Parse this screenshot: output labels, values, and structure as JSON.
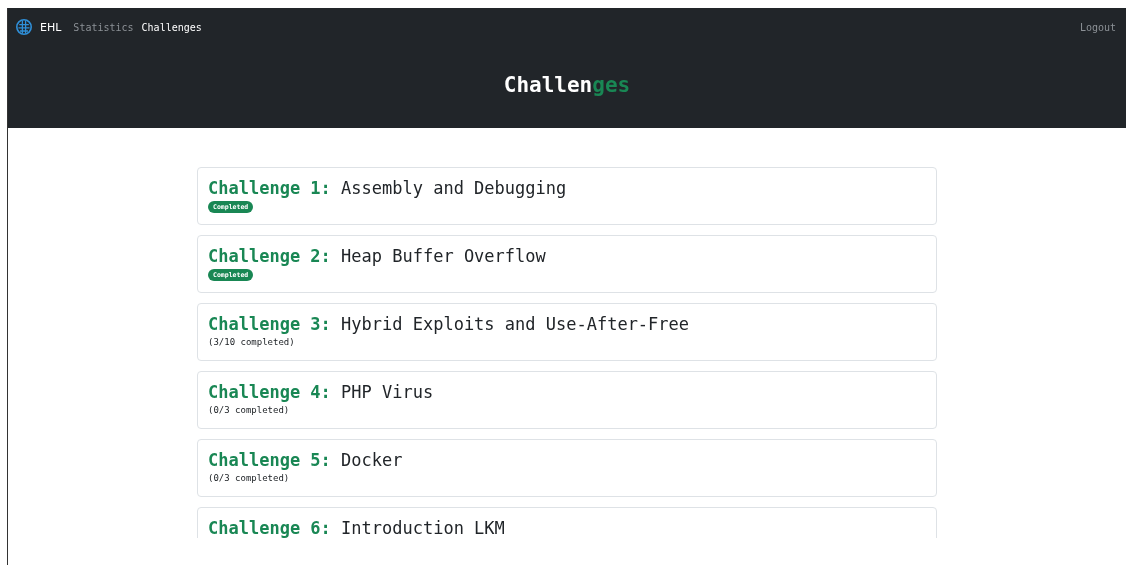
{
  "navbar": {
    "brand": "EHL",
    "links": [
      {
        "label": "Statistics",
        "selected": false
      },
      {
        "label": "Challenges",
        "selected": true
      }
    ],
    "logout": "Logout"
  },
  "header": {
    "title_parts": [
      {
        "text": "Challen",
        "accent": false
      },
      {
        "text": "ges",
        "accent": true
      }
    ]
  },
  "challenges": [
    {
      "label": "Challenge 1:",
      "title": "Assembly and Debugging",
      "status": {
        "kind": "badge",
        "text": "Completed"
      }
    },
    {
      "label": "Challenge 2:",
      "title": "Heap Buffer Overflow",
      "status": {
        "kind": "badge",
        "text": "Completed"
      }
    },
    {
      "label": "Challenge 3:",
      "title": "Hybrid Exploits and Use-After-Free",
      "status": {
        "kind": "progress",
        "text": "(3/10 completed)"
      }
    },
    {
      "label": "Challenge 4:",
      "title": "PHP Virus",
      "status": {
        "kind": "progress",
        "text": "(0/3 completed)"
      }
    },
    {
      "label": "Challenge 5:",
      "title": "Docker",
      "status": {
        "kind": "progress",
        "text": "(0/3 completed)"
      }
    },
    {
      "label": "Challenge 6:",
      "title": "Introduction LKM"
    }
  ]
}
